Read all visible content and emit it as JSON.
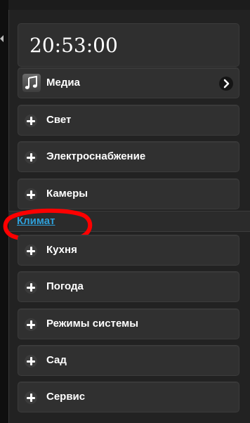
{
  "clock": {
    "time": "20:53:00"
  },
  "menu": {
    "media": {
      "label": "Медиа",
      "icon": "music-note-icon"
    },
    "items_top": [
      {
        "label": "Свет"
      },
      {
        "label": "Электроснабжение"
      },
      {
        "label": "Камеры"
      }
    ],
    "section_link": "Климат",
    "items_bottom": [
      {
        "label": "Кухня"
      },
      {
        "label": "Погода"
      },
      {
        "label": "Режимы системы"
      },
      {
        "label": "Сад"
      },
      {
        "label": "Сервис"
      }
    ]
  },
  "annotation": {
    "color": "#ff0000"
  },
  "colors": {
    "background": "#1c1c1c",
    "item": "#303030",
    "link": "#2e9fd9"
  }
}
